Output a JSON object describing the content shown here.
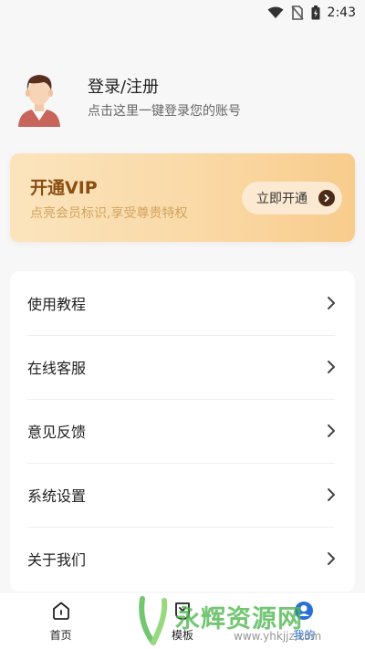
{
  "status_bar": {
    "time": "2:43",
    "icons": [
      "wifi-icon",
      "no-sim-icon",
      "battery-charging-icon"
    ]
  },
  "profile": {
    "title": "登录/注册",
    "subtitle": "点击这里一键登录您的账号",
    "avatar_icon": "default-avatar-icon"
  },
  "vip": {
    "title": "开通VIP",
    "subtitle": "点亮会员标识,享受尊贵特权",
    "button_label": "立即开通",
    "colors": {
      "title": "#8a4e13",
      "subtitle": "#d3a35f",
      "gradient_start": "#fbe4bd",
      "gradient_end": "#f8cc8c"
    }
  },
  "menu": {
    "items": [
      {
        "label": "使用教程"
      },
      {
        "label": "在线客服"
      },
      {
        "label": "意见反馈"
      },
      {
        "label": "系统设置"
      },
      {
        "label": "关于我们"
      }
    ]
  },
  "bottom_nav": {
    "items": [
      {
        "label": "首页",
        "icon": "home-icon"
      },
      {
        "label": "模板",
        "icon": "template-icon"
      },
      {
        "label": "我的",
        "icon": "profile-icon",
        "active": true
      }
    ]
  },
  "watermark": {
    "text": "永辉资源网",
    "url": "www.yhkjjz.com"
  }
}
